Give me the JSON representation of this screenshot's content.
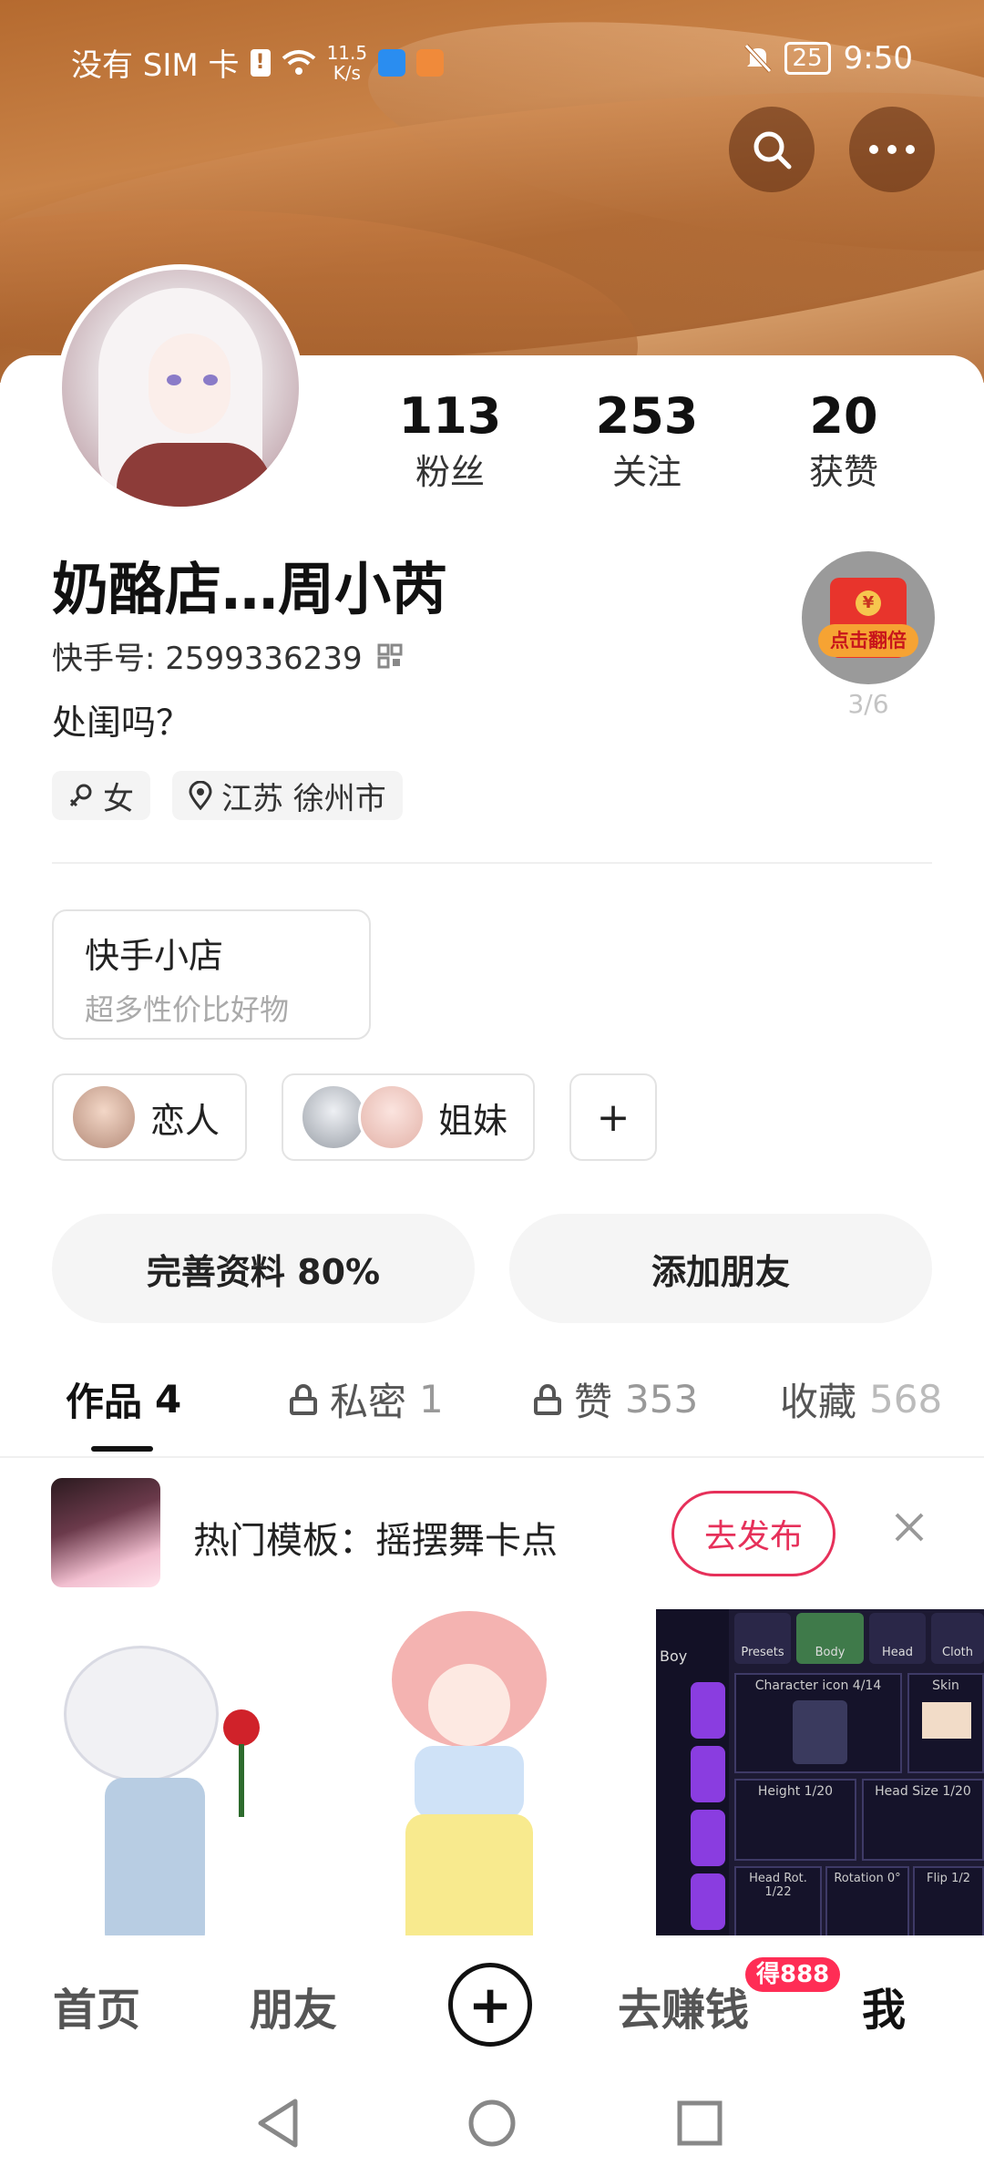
{
  "status_bar": {
    "carrier": "没有 SIM 卡",
    "net_speed_value": "11.5",
    "net_speed_unit": "K/s",
    "battery": "25",
    "time": "9:50"
  },
  "header": {
    "search_icon": "search-icon",
    "more_icon": "more-icon"
  },
  "profile": {
    "name": "奶酪店…周小芮",
    "kuaishou_id": "快手号: 2599336239",
    "bio": "处闺吗？",
    "gender_tag": "女",
    "location_tag": "江苏 徐州市",
    "stats": [
      {
        "value": "113",
        "label": "粉丝"
      },
      {
        "value": "253",
        "label": "关注"
      },
      {
        "value": "20",
        "label": "获赞"
      }
    ],
    "red_packet": {
      "badge": "点击翻倍",
      "coin": "¥",
      "count": "3/6"
    }
  },
  "shop": {
    "title": "快手小店",
    "subtitle": "超多性价比好物"
  },
  "relations": [
    {
      "label": "恋人"
    },
    {
      "label": "姐妹"
    },
    {
      "label": "+"
    }
  ],
  "actions": {
    "complete_profile": "完善资料 80%",
    "add_friend": "添加朋友"
  },
  "tabs": [
    {
      "label": "作品",
      "count": "4"
    },
    {
      "label": "私密",
      "count": "1"
    },
    {
      "label": "赞",
      "count": "353"
    },
    {
      "label": "收藏",
      "count": "568"
    }
  ],
  "promo": {
    "text": "热门模板：摇摆舞卡点",
    "button": "去发布"
  },
  "game_ui": {
    "boy": "Boy",
    "tabs": [
      "Presets",
      "Body",
      "Head",
      "Cloth"
    ],
    "character_icon": "Character icon 4/14",
    "skin": "Skin",
    "height": "Height 1/20",
    "head_size": "Head Size 1/20",
    "head_rot": "Head Rot. 1/22",
    "rotation": "Rotation 0°",
    "flip": "Flip 1/2"
  },
  "bottom_nav": {
    "home": "首页",
    "friends": "朋友",
    "plus": "+",
    "earn": "去赚钱",
    "earn_badge": "得888",
    "me": "我"
  }
}
